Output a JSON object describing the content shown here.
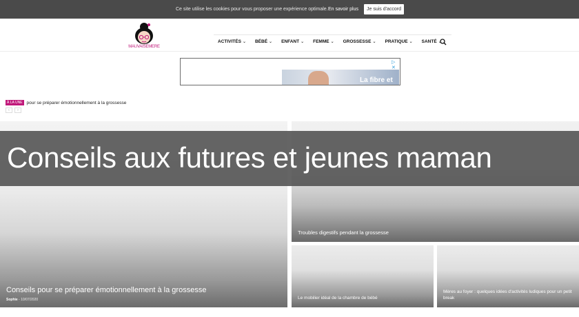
{
  "cookie_bar": {
    "text": "Ce site utilise les cookies pour vous proposer une expérience optimale.",
    "more_link": "En savoir plus",
    "accept_button": "Je suis d'accord"
  },
  "header": {
    "logo_text": "MAUVAISEMERE",
    "nav": [
      {
        "label": "ACTIVITÉS"
      },
      {
        "label": "BÉBÉ"
      },
      {
        "label": "ENFANT"
      },
      {
        "label": "FEMME"
      },
      {
        "label": "GROSSESSE"
      },
      {
        "label": "PRATIQUE"
      },
      {
        "label": "SANTÉ"
      }
    ],
    "search_icon": "search-icon"
  },
  "ad": {
    "choices_label": "▷ ✕",
    "headline": "La fibre et"
  },
  "ticker": {
    "badge": "À LA UNE",
    "text": "pour se préparer émotionnellement à la grossesse"
  },
  "overlay": {
    "title": "Conseils aux futures et jeunes maman"
  },
  "posts": {
    "big": {
      "title": "Conseils pour se préparer émotionnellement à la grossesse",
      "author": "Sophie",
      "date": "10/07/2020"
    },
    "top_right": {
      "title": "Troubles digestifs pendant la grossesse"
    },
    "bottom_middle": {
      "title": "Le mobilier idéal de la chambre de bébé"
    },
    "bottom_right": {
      "title": "Mères au foyer : quelques idées d'activités ludiques pour un petit break"
    }
  },
  "colors": {
    "brand": "#c0187a",
    "cookie_bar": "#4a4a4a",
    "overlay": "#505050"
  }
}
